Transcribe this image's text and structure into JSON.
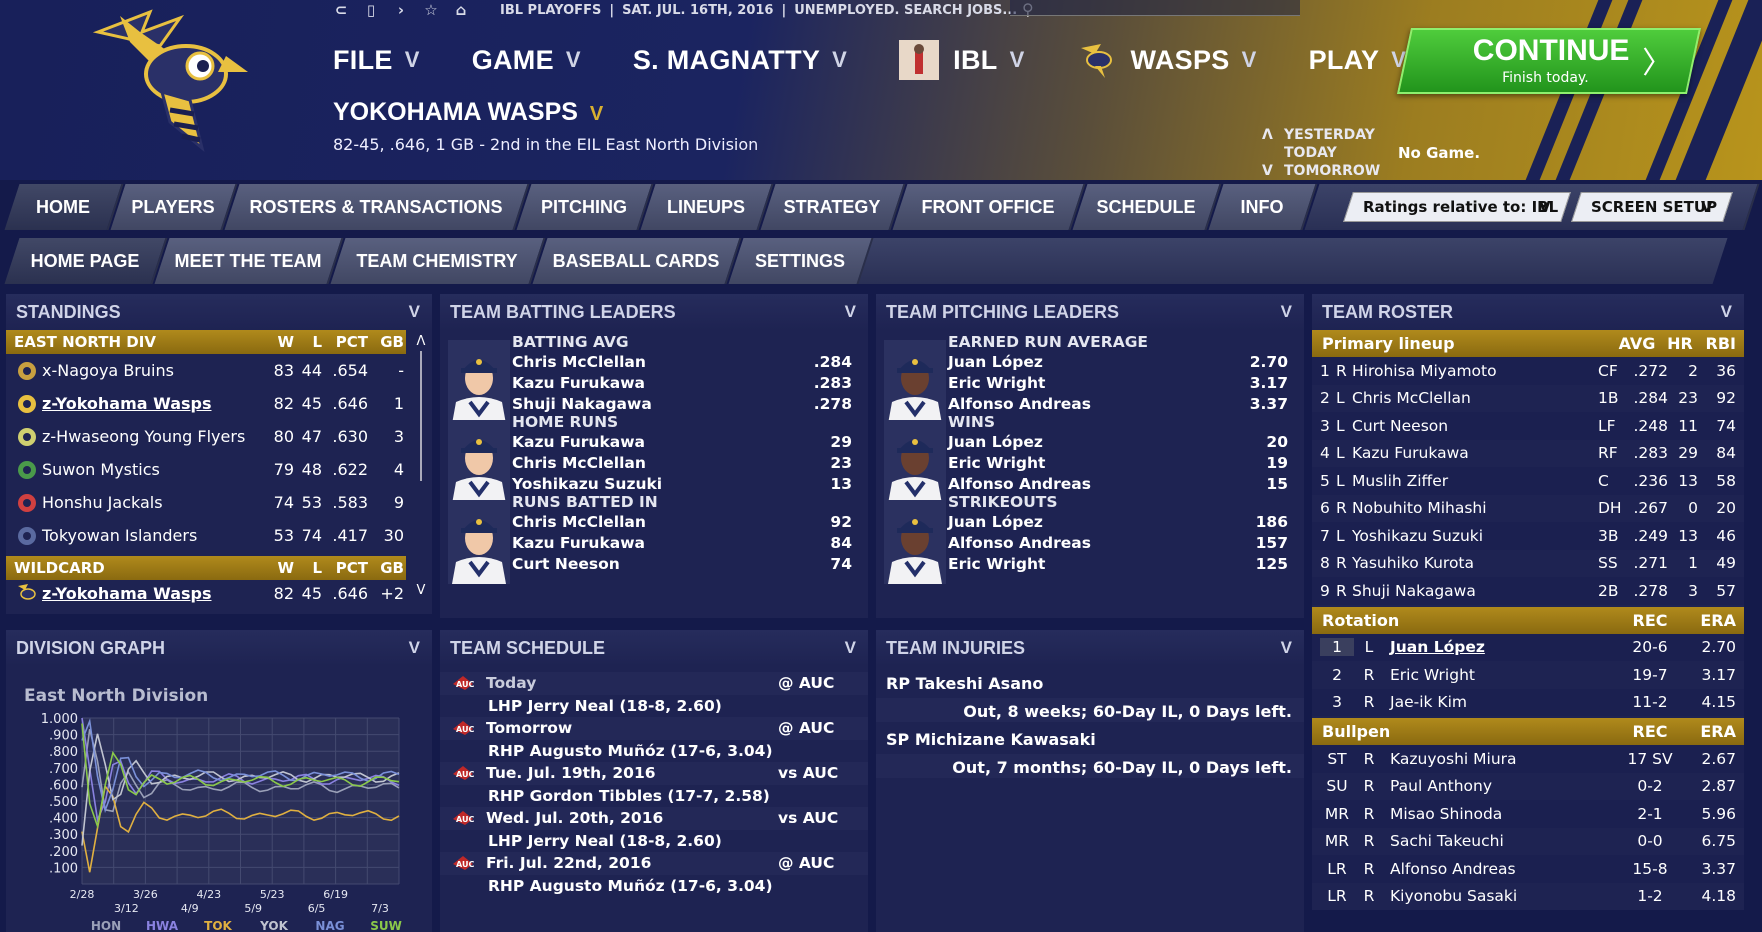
{
  "topbar": {
    "league": "IBL PLAYOFFS",
    "date": "SAT. JUL. 16TH, 2016",
    "status": "UNEMPLOYED. SEARCH JOBS..."
  },
  "menu": {
    "file": "FILE",
    "game": "GAME",
    "manager": "S. MAGNATTY",
    "league": "IBL",
    "team": "WASPS",
    "play": "PLAY"
  },
  "continue": {
    "label": "CONTINUE",
    "sub": "Finish today."
  },
  "team": {
    "name": "YOKOHAMA WASPS",
    "record": "82-45, .646, 1 GB - 2nd in the EIL East North Division"
  },
  "days": {
    "yesterday": "YESTERDAY",
    "today": "TODAY",
    "tomorrow": "TOMORROW",
    "today_status": "No Game."
  },
  "tabs": [
    "HOME",
    "PLAYERS",
    "ROSTERS & TRANSACTIONS",
    "PITCHING",
    "LINEUPS",
    "STRATEGY",
    "FRONT OFFICE",
    "SCHEDULE",
    "INFO"
  ],
  "ratings_dropdown": "Ratings relative to: IBL",
  "screen_setup": "SCREEN SETUP",
  "subtabs": [
    "HOME PAGE",
    "MEET THE TEAM",
    "TEAM CHEMISTRY",
    "BASEBALL CARDS",
    "SETTINGS"
  ],
  "standings": {
    "title": "STANDINGS",
    "div": "EAST NORTH DIV",
    "cols": [
      "W",
      "L",
      "PCT",
      "GB"
    ],
    "rows": [
      [
        "x-Nagoya Bruins",
        "83",
        "44",
        ".654",
        "-"
      ],
      [
        "z-Yokohama Wasps",
        "82",
        "45",
        ".646",
        "1"
      ],
      [
        "z-Hwaseong Young Flyers",
        "80",
        "47",
        ".630",
        "3"
      ],
      [
        "Suwon Mystics",
        "79",
        "48",
        ".622",
        "4"
      ],
      [
        "Honshu Jackals",
        "74",
        "53",
        ".583",
        "9"
      ],
      [
        "Tokyowan Islanders",
        "53",
        "74",
        ".417",
        "30"
      ]
    ],
    "wild": "WILDCARD",
    "wild_row": [
      "z-Yokohama Wasps",
      "82",
      "45",
      ".646",
      "+2"
    ]
  },
  "batting": {
    "title": "TEAM BATTING LEADERS",
    "groups": [
      {
        "cat": "BATTING AVG",
        "rows": [
          [
            "Chris McClellan",
            ".284"
          ],
          [
            "Kazu Furukawa",
            ".283"
          ],
          [
            "Shuji Nakagawa",
            ".278"
          ]
        ]
      },
      {
        "cat": "HOME RUNS",
        "rows": [
          [
            "Kazu Furukawa",
            "29"
          ],
          [
            "Chris McClellan",
            "23"
          ],
          [
            "Yoshikazu Suzuki",
            "13"
          ]
        ]
      },
      {
        "cat": "RUNS BATTED IN",
        "rows": [
          [
            "Chris McClellan",
            "92"
          ],
          [
            "Kazu Furukawa",
            "84"
          ],
          [
            "Curt Neeson",
            "74"
          ]
        ]
      }
    ]
  },
  "pitching": {
    "title": "TEAM PITCHING LEADERS",
    "groups": [
      {
        "cat": "EARNED RUN AVERAGE",
        "rows": [
          [
            "Juan López",
            "2.70"
          ],
          [
            "Eric Wright",
            "3.17"
          ],
          [
            "Alfonso Andreas",
            "3.37"
          ]
        ]
      },
      {
        "cat": "WINS",
        "rows": [
          [
            "Juan López",
            "20"
          ],
          [
            "Eric Wright",
            "19"
          ],
          [
            "Alfonso Andreas",
            "15"
          ]
        ]
      },
      {
        "cat": "STRIKEOUTS",
        "rows": [
          [
            "Juan López",
            "186"
          ],
          [
            "Alfonso Andreas",
            "157"
          ],
          [
            "Eric Wright",
            "125"
          ]
        ]
      }
    ]
  },
  "roster": {
    "title": "TEAM ROSTER",
    "lineup_h": "Primary lineup",
    "lineup_cols": [
      "AVG",
      "HR",
      "RBI"
    ],
    "lineup": [
      [
        "1",
        "R",
        "Hirohisa Miyamoto",
        "CF",
        ".272",
        "2",
        "36"
      ],
      [
        "2",
        "L",
        "Chris McClellan",
        "1B",
        ".284",
        "23",
        "92"
      ],
      [
        "3",
        "L",
        "Curt Neeson",
        "LF",
        ".248",
        "11",
        "74"
      ],
      [
        "4",
        "L",
        "Kazu Furukawa",
        "RF",
        ".283",
        "29",
        "84"
      ],
      [
        "5",
        "L",
        "Muslih Ziffer",
        "C",
        ".236",
        "13",
        "58"
      ],
      [
        "6",
        "R",
        "Nobuhito Mihashi",
        "DH",
        ".267",
        "0",
        "20"
      ],
      [
        "7",
        "L",
        "Yoshikazu Suzuki",
        "3B",
        ".249",
        "13",
        "46"
      ],
      [
        "8",
        "R",
        "Yasuhiko Kurota",
        "SS",
        ".271",
        "1",
        "49"
      ],
      [
        "9",
        "R",
        "Shuji Nakagawa",
        "2B",
        ".278",
        "3",
        "57"
      ]
    ],
    "rot_h": "Rotation",
    "rot_cols": [
      "REC",
      "ERA"
    ],
    "rotation": [
      [
        "1",
        "L",
        "Juan López",
        "20-6",
        "2.70"
      ],
      [
        "2",
        "R",
        "Eric Wright",
        "19-7",
        "3.17"
      ],
      [
        "3",
        "R",
        "Jae-ik Kim",
        "11-2",
        "4.15"
      ]
    ],
    "pen_h": "Bullpen",
    "bullpen": [
      [
        "ST",
        "R",
        "Kazuyoshi Miura",
        "17 SV",
        "2.67"
      ],
      [
        "SU",
        "R",
        "Paul Anthony",
        "0-2",
        "2.87"
      ],
      [
        "MR",
        "R",
        "Misao Shinoda",
        "2-1",
        "5.96"
      ],
      [
        "MR",
        "R",
        "Sachi Takeuchi",
        "0-0",
        "6.75"
      ],
      [
        "LR",
        "R",
        "Alfonso Andreas",
        "15-8",
        "3.37"
      ],
      [
        "LR",
        "R",
        "Kiyonobu Sasaki",
        "1-2",
        "4.18"
      ]
    ]
  },
  "graph": {
    "title": "DIVISION GRAPH",
    "label": "East North Division",
    "yticks": [
      "1.000",
      ".900",
      ".800",
      ".700",
      ".600",
      ".500",
      ".400",
      ".300",
      ".200",
      ".100"
    ],
    "xticks": [
      "2/28",
      "3/12",
      "3/26",
      "4/9",
      "4/23",
      "5/9",
      "5/23",
      "6/5",
      "6/19",
      "7/3"
    ],
    "legend": [
      "HON",
      "HWA",
      "TOK",
      "YOK",
      "NAG",
      "SUW"
    ]
  },
  "schedule": {
    "title": "TEAM SCHEDULE",
    "games": [
      {
        "day": "Today",
        "loc": "@ AUC",
        "pitcher": "LHP Jerry Neal (18-8, 2.60)"
      },
      {
        "day": "Tomorrow",
        "loc": "@ AUC",
        "pitcher": "RHP Augusto Muñóz (17-6, 3.04)"
      },
      {
        "day": "Tue. Jul. 19th, 2016",
        "loc": "vs AUC",
        "pitcher": "RHP Gordon Tibbles (17-7, 2.58)"
      },
      {
        "day": "Wed. Jul. 20th, 2016",
        "loc": "vs AUC",
        "pitcher": "LHP Jerry Neal (18-8, 2.60)"
      },
      {
        "day": "Fri. Jul. 22nd, 2016",
        "loc": "@ AUC",
        "pitcher": "RHP Augusto Muñóz (17-6, 3.04)"
      }
    ]
  },
  "injuries": {
    "title": "TEAM INJURIES",
    "list": [
      {
        "player": "RP Takeshi Asano",
        "detail": "Out, 8 weeks; 60-Day IL, 0 Days left."
      },
      {
        "player": "SP Michizane Kawasaki",
        "detail": "Out, 7 months; 60-Day IL, 0 Days left."
      }
    ]
  },
  "colors": {
    "gold": "#b08a1c",
    "panel": "#1e2352",
    "continue": "#3bb52e"
  }
}
